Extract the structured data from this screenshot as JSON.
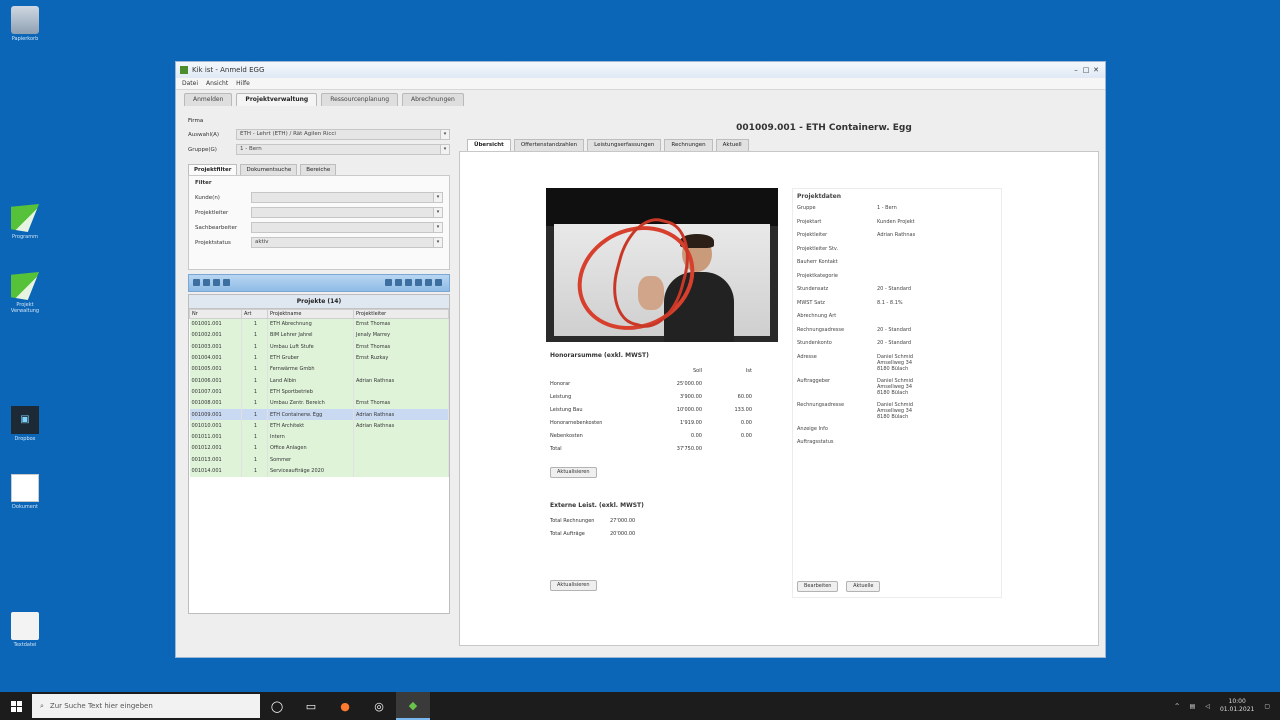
{
  "desktop": {
    "icons": [
      {
        "label": "Papierkorb"
      },
      {
        "label": "Programm"
      },
      {
        "label": "Projekt Verwaltung"
      },
      {
        "label": "Dropbox"
      },
      {
        "label": "Dokument"
      },
      {
        "label": "Textdatei"
      }
    ]
  },
  "window": {
    "title": "Kik ist - Anmeld EGG",
    "menu": [
      "Datei",
      "Ansicht",
      "Hilfe"
    ],
    "tabs": [
      "Anmelden",
      "Projektverwaltung",
      "Ressourcenplanung",
      "Abrechnungen"
    ],
    "active_tab": 1
  },
  "left": {
    "firma_label": "Firma",
    "rows": [
      {
        "label": "Auswahl(A)",
        "value": "ETH - Lehrt (ETH) / Rät Agilen Ricci"
      },
      {
        "label": "Gruppe(G)",
        "value": "1 - Bern"
      }
    ],
    "subtabs": [
      "Projektfilter",
      "Dokumentsuche",
      "Bereiche"
    ],
    "filter_title": "Filter",
    "filters": [
      {
        "label": "Kunde(n)",
        "value": ""
      },
      {
        "label": "Projektleiter",
        "value": ""
      },
      {
        "label": "Sachbearbeiter",
        "value": ""
      },
      {
        "label": "Projektstatus",
        "value": "aktiv"
      }
    ],
    "list_title": "Projekte (14)",
    "columns": [
      "Nr",
      "Art",
      "Projektname",
      "Projektleiter"
    ],
    "projects": [
      [
        "001001.001",
        "1",
        "ETH Abrechnung",
        "Ernst Thomas"
      ],
      [
        "001002.001",
        "1",
        "BIM Lehrer Jahrel",
        "Jenaly Marrey"
      ],
      [
        "001003.001",
        "1",
        "Umbau Luft Stufe",
        "Ernst Thomas"
      ],
      [
        "001004.001",
        "1",
        "ETH Gruber",
        "Ernst Ruzkay"
      ],
      [
        "001005.001",
        "1",
        "Fernwärme Gmbh",
        ""
      ],
      [
        "001006.001",
        "1",
        "Land Albin",
        "Adrian Rathnas"
      ],
      [
        "001007.001",
        "1",
        "ETH Sportbetrieb",
        ""
      ],
      [
        "001008.001",
        "1",
        "Umbau Zentr. Bereich",
        "Ernst Thomas"
      ],
      [
        "001009.001",
        "1",
        "ETH Containerw. Egg",
        "Adrian Rathnas"
      ],
      [
        "001010.001",
        "1",
        "ETH Architekt",
        "Adrian Rathnas"
      ],
      [
        "001011.001",
        "1",
        "Intern",
        ""
      ],
      [
        "001012.001",
        "1",
        "Office Anlagen",
        ""
      ],
      [
        "001013.001",
        "1",
        "Sommer",
        ""
      ],
      [
        "001014.001",
        "1",
        "Serviceaufträge 2020",
        ""
      ]
    ],
    "selected_index": 8
  },
  "right": {
    "project_title": "001009.001 - ETH Containerw. Egg",
    "tabs": [
      "Übersicht",
      "Offertenstandzahlen",
      "Leistungserfassungen",
      "Rechnungen",
      "Aktuell"
    ],
    "active_tab": 0,
    "honorar_title": "Honorarsumme (exkl. MWST)",
    "honorar_cols": [
      "Soll",
      "Ist"
    ],
    "honorar_rows": [
      [
        "Honorar",
        "25'000.00",
        ""
      ],
      [
        "Leistung",
        "3'900.00",
        "60.00"
      ],
      [
        "Leistung Bau",
        "10'000.00",
        "133.00"
      ],
      [
        "Honorarnebenkosten",
        "1'919.00",
        "0.00"
      ],
      [
        "Nebenkosten",
        "0.00",
        "0.00"
      ],
      [
        "Total",
        "37'750.00",
        ""
      ]
    ],
    "honorar_button": "Aktualisieren",
    "extern_title": "Externe Leist. (exkl. MWST)",
    "extern_rows": [
      [
        "Total Rechnungen",
        "27'000.00"
      ],
      [
        "Total Aufträge",
        "20'000.00"
      ]
    ],
    "extern_button": "Aktualisieren",
    "details_title": "Projektdaten",
    "details": [
      [
        "Gruppe",
        "1 - Bern"
      ],
      [
        "Projektart",
        "Kunden Projekt"
      ],
      [
        "Projektleiter",
        "Adrian Rathnas"
      ],
      [
        "Projektleiter Stv.",
        ""
      ],
      [
        "Bauherr Kontakt",
        ""
      ],
      [
        "Projektkategorie",
        ""
      ],
      [
        "Stundensatz",
        "20 - Standard"
      ],
      [
        "MWST Satz",
        "8.1 - 8.1%"
      ],
      [
        "Abrechnung Art",
        ""
      ],
      [
        "Rechnungsadresse",
        "20 - Standard"
      ],
      [
        "Stundenkonto",
        "20 - Standard"
      ],
      [
        "Adresse",
        "Daniel Schmid\nAmsellweg 34\n8180 Bülach"
      ],
      [
        "Auftraggeber",
        "Daniel Schmid\nAmsellweg 34\n8180 Bülach"
      ],
      [
        "Rechnungsadresse",
        "Daniel Schmid\nAmsellweg 34\n8180 Bülach"
      ],
      [
        "Anzeige Info",
        ""
      ],
      [
        "Auftragsstatus",
        ""
      ]
    ],
    "details_buttons": [
      "Bearbeiten",
      "Aktuelle"
    ]
  },
  "taskbar": {
    "search_placeholder": "Zur Suche Text hier eingeben",
    "clock_time": "10:00",
    "clock_date": "01.01.2021"
  }
}
